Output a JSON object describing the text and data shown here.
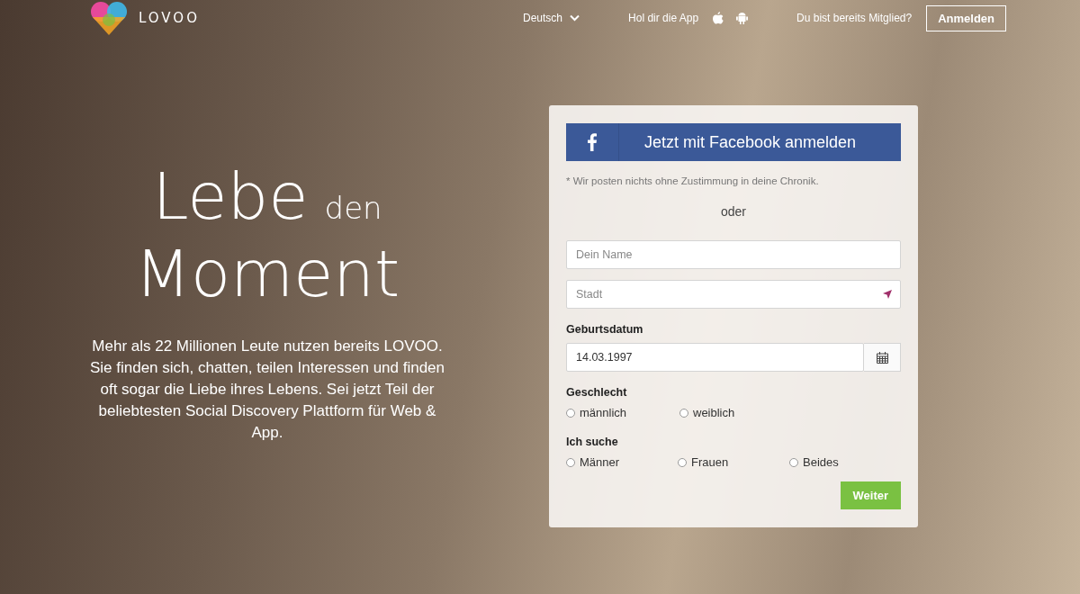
{
  "header": {
    "brand": "LOVOO",
    "language": "Deutsch",
    "app_prompt": "Hol dir die App",
    "member_prompt": "Du bist bereits Mitglied?",
    "login_button": "Anmelden"
  },
  "hero": {
    "headline_line_1": [
      "Lebe",
      "den"
    ],
    "headline_line_2": "Moment",
    "text": "Mehr als 22 Millionen Leute nutzen bereits LOVOO. Sie finden sich, chatten, teilen Interessen und finden oft sogar die Liebe ihres Lebens. Sei jetzt Teil der beliebtesten Social Discovery Plattform für Web & App."
  },
  "signup": {
    "facebook_button": "Jetzt mit Facebook anmelden",
    "facebook_note": "* Wir posten nichts ohne Zustimmung in deine Chronik.",
    "separator": "oder",
    "name_field": {
      "placeholder": "Dein Name"
    },
    "city_field": {
      "placeholder": "Stadt"
    },
    "birthdate": {
      "label": "Geburtsdatum",
      "value": "14.03.1997"
    },
    "gender": {
      "label": "Geschlecht",
      "options": [
        {
          "label": "männlich",
          "selected": false
        },
        {
          "label": "weiblich",
          "selected": false
        }
      ]
    },
    "looking_for": {
      "label": "Ich suche",
      "options": [
        {
          "label": "Männer",
          "selected": false
        },
        {
          "label": "Frauen",
          "selected": false
        },
        {
          "label": "Beides",
          "selected": false
        }
      ]
    },
    "submit_button": "Weiter"
  }
}
